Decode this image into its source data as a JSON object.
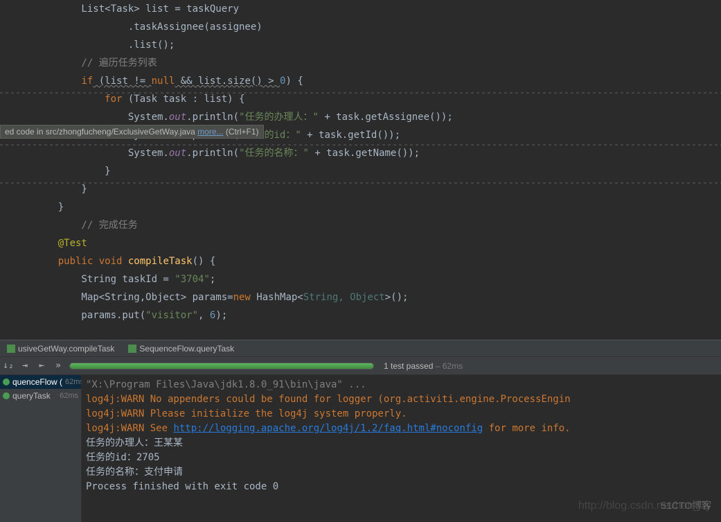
{
  "code": {
    "l0": "        List<Task> list = taskQuery",
    "l1": "                .taskAssignee(assignee)",
    "l2": "                .list();",
    "l3": "        // 遍历任务列表",
    "l4_if": "if",
    "l4_list": " (list != ",
    "l4_null": "null",
    "l4_rest": " && list.size() > ",
    "l4_zero": "0",
    "l4_end": ") {",
    "l5_for": "for",
    "l5_rest": " (Task task : list) {",
    "l6_a": "System.",
    "l6_out": "out",
    "l6_b": ".println(",
    "l6_s": "\"任务的办理人：\"",
    "l6_c": " + task.getAssignee());",
    "l7_a": "System.",
    "l7_out": "out",
    "l7_b": ".println(",
    "l7_s": "\"任务的id：\"",
    "l7_c": " + task.getId());",
    "l8_a": "System.",
    "l8_out": "out",
    "l8_b": ".println(",
    "l8_s": "\"任务的名称：\"",
    "l8_c": " + task.getName());",
    "l9": "            }",
    "l10": "        }",
    "l11": "",
    "l12": "    }",
    "l13": "",
    "l14": "    // 完成任务",
    "l15_anno": "@Test",
    "l16_pub": "public",
    "l16_void": " void ",
    "l16_name": "compileTask",
    "l16_end": "() {",
    "l17_a": "        String taskId = ",
    "l17_s": "\"3704\"",
    "l17_b": ";",
    "l18_a": "        Map<String,Object> params=",
    "l18_new": "new",
    "l18_b": " HashMap<",
    "l18_gen": "String, Object",
    "l18_c": ">();",
    "l19_a": "        params.put(",
    "l19_s": "\"visitor\"",
    "l19_b": ", ",
    "l19_n": "6",
    "l19_c": ");"
  },
  "tooltip": {
    "prefix": "ed code in src/zhongfucheng/ExclusiveGetWay.java ",
    "link": "more...",
    "suffix": " (Ctrl+F1)"
  },
  "tabs": {
    "tab1": "usiveGetWay.compileTask",
    "tab2": "SequenceFlow.queryTask"
  },
  "test": {
    "passed": "1 test passed",
    "time": " – 62ms",
    "tree_node1": "quenceFlow (",
    "tree_node1_time": "62ms",
    "tree_node2": "queryTask",
    "tree_node2_time": "62ms"
  },
  "console": {
    "cmd": "\"X:\\Program Files\\Java\\jdk1.8.0_91\\bin\\java\" ...",
    "w1": "log4j:WARN No appenders could be found for logger (org.activiti.engine.ProcessEngin",
    "w2": "log4j:WARN Please initialize the log4j system properly.",
    "w3a": "log4j:WARN See ",
    "w3link": "http://logging.apache.org/log4j/1.2/faq.html#noconfig",
    "w3b": " for more info.",
    "o1": "任务的办理人：王某某",
    "o2": "任务的id：2705",
    "o3": "任务的名称：支付申请",
    "o4": "",
    "o5": "Process finished with exit code 0"
  },
  "watermark1": "http://blog.csdn.net/hon_3y",
  "watermark2": "51CTO博客"
}
